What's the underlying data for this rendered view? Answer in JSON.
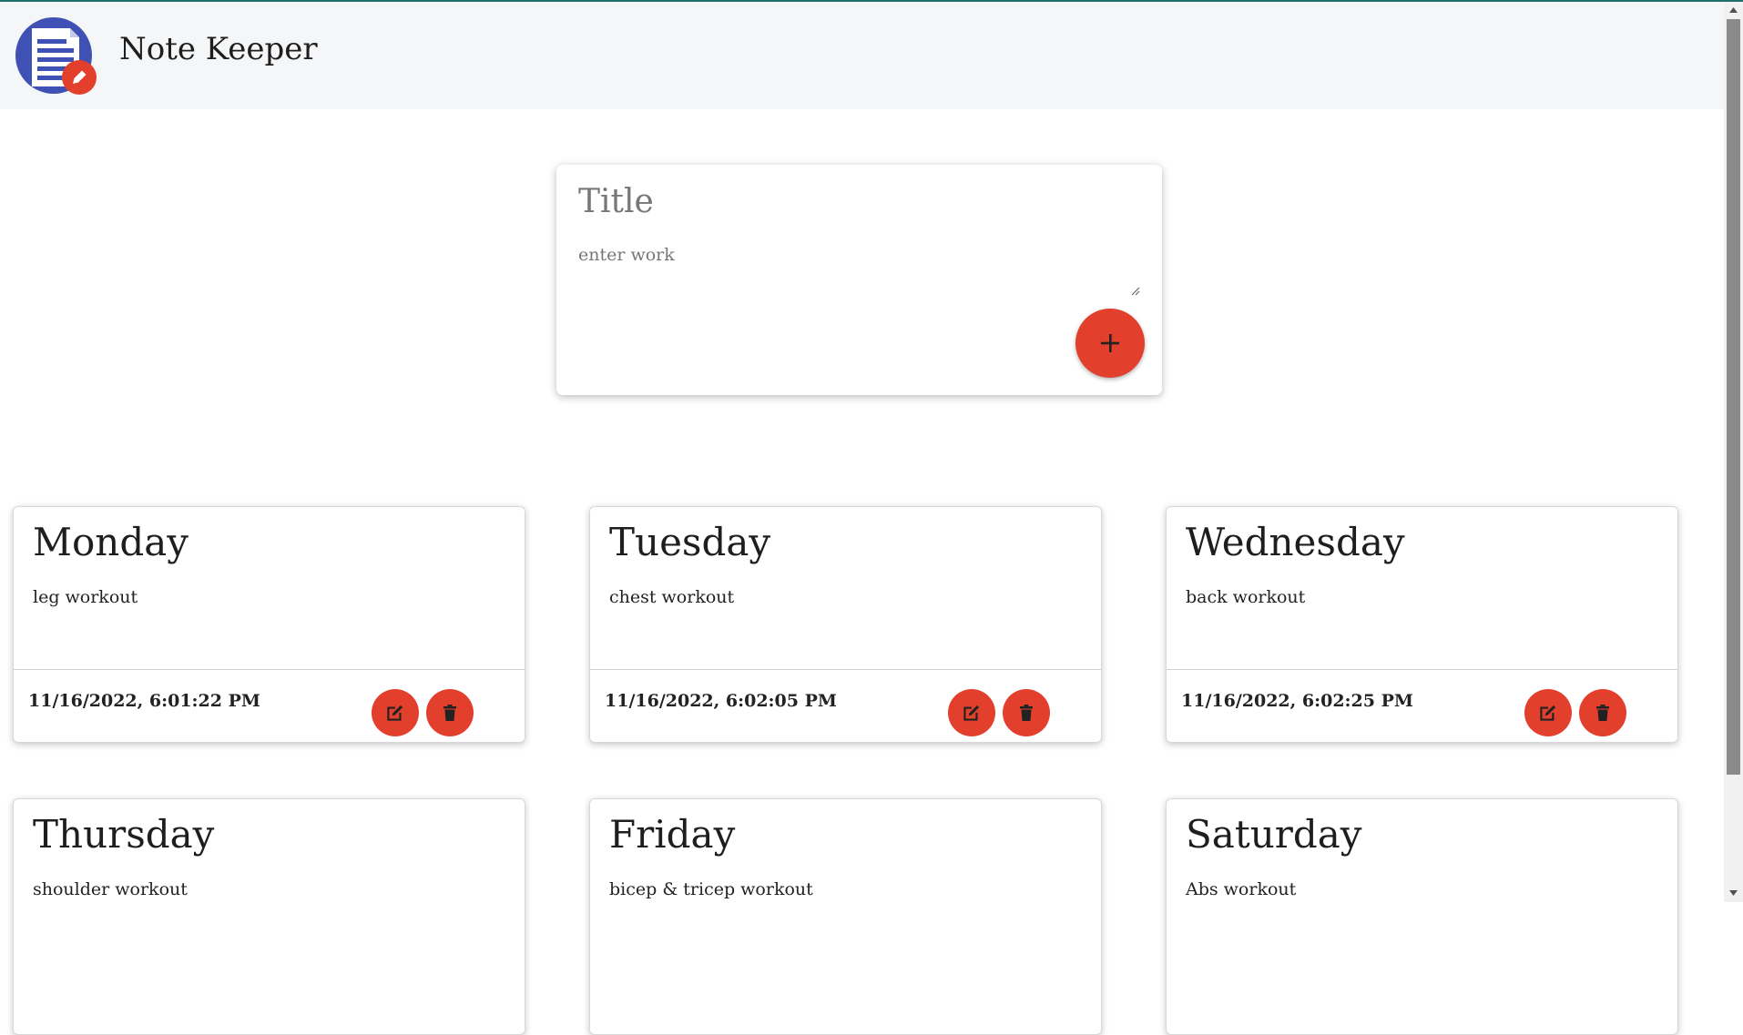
{
  "header": {
    "app_title": "Note Keeper",
    "logo_icon": "notepad-pencil-logo"
  },
  "composer": {
    "title_placeholder": "Title",
    "body_placeholder": "enter work",
    "add_icon": "plus-icon"
  },
  "notes": [
    {
      "title": "Monday",
      "body": "leg workout",
      "date": "11/16/2022, 6:01:22 PM"
    },
    {
      "title": "Tuesday",
      "body": "chest workout",
      "date": "11/16/2022, 6:02:05 PM"
    },
    {
      "title": "Wednesday",
      "body": "back workout",
      "date": "11/16/2022, 6:02:25 PM"
    },
    {
      "title": "Thursday",
      "body": "shoulder workout",
      "date": ""
    },
    {
      "title": "Friday",
      "body": "bicep & tricep workout",
      "date": ""
    },
    {
      "title": "Saturday",
      "body": "Abs workout",
      "date": ""
    }
  ],
  "colors": {
    "accent": "#e23f2d",
    "header_bg": "#f5f6f8",
    "logo_blue": "#3f51b5"
  }
}
